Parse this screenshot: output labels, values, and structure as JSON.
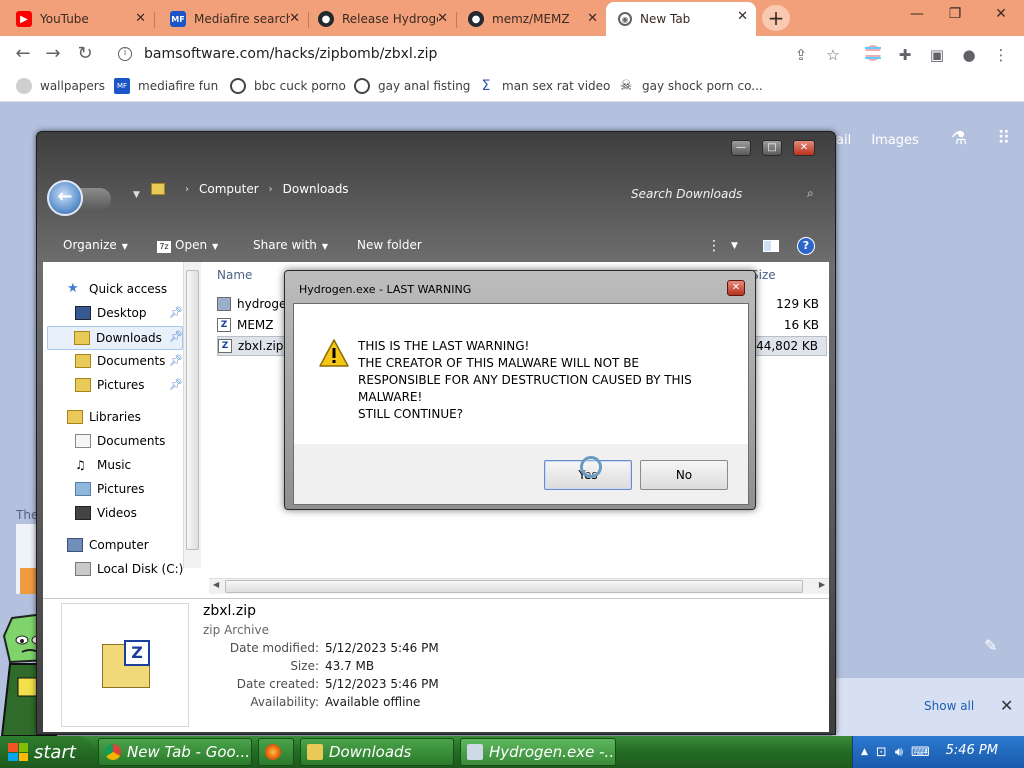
{
  "browser": {
    "tabs": [
      {
        "label": "YouTube"
      },
      {
        "label": "Mediafire search"
      },
      {
        "label": "Release Hydrogen"
      },
      {
        "label": "memz/MEMZ"
      },
      {
        "label": "New Tab",
        "active": true
      }
    ],
    "url": "bamsoftware.com/hacks/zipbomb/zbxl.zip",
    "bookmarks": [
      "wallpapers",
      "mediafire fun",
      "bbc cuck porno",
      "gay anal fisting",
      "man sex rat video",
      "gay shock porn co..."
    ]
  },
  "newtab_page": {
    "links": [
      "ail",
      "Images"
    ],
    "fragment_text": "The",
    "downloads_bar": {
      "show_all": "Show all"
    }
  },
  "explorer": {
    "breadcrumb": [
      "Computer",
      "Downloads"
    ],
    "search_placeholder": "Search Downloads",
    "commands": {
      "organize": "Organize",
      "open": "Open",
      "share": "Share with",
      "new_folder": "New folder"
    },
    "nav": {
      "quick_access": "Quick access",
      "desktop": "Desktop",
      "downloads": "Downloads",
      "documents": "Documents",
      "pictures": "Pictures",
      "libraries": "Libraries",
      "lib_documents": "Documents",
      "music": "Music",
      "lib_pictures": "Pictures",
      "videos": "Videos",
      "computer": "Computer",
      "local_disk": "Local Disk (C:)"
    },
    "columns": {
      "name": "Name",
      "size": "Size"
    },
    "files": [
      {
        "name": "hydrogen",
        "size": "129 KB"
      },
      {
        "name": "MEMZ",
        "size": "16 KB"
      },
      {
        "name": "zbxl.zip",
        "size": "44,802 KB"
      }
    ],
    "details": {
      "filename": "zbxl.zip",
      "type": "zip Archive",
      "date_modified_label": "Date modified:",
      "date_modified": "5/12/2023 5:46 PM",
      "size_label": "Size:",
      "size": "43.7 MB",
      "date_created_label": "Date created:",
      "date_created": "5/12/2023 5:46 PM",
      "availability_label": "Availability:",
      "availability": "Available offline"
    }
  },
  "dialog": {
    "title": "Hydrogen.exe - LAST WARNING",
    "lines": [
      "THIS IS THE LAST WARNING!",
      "THE CREATOR OF THIS MALWARE WILL NOT BE",
      "RESPONSIBLE FOR ANY DESTRUCTION CAUSED BY THIS",
      "MALWARE!",
      "STILL CONTINUE?"
    ],
    "yes": "Yes",
    "no": "No"
  },
  "taskbar": {
    "start": "start",
    "tasks": [
      "New Tab - Goo...",
      "Downloads",
      "Hydrogen.exe -..."
    ],
    "clock": "5:46 PM"
  }
}
